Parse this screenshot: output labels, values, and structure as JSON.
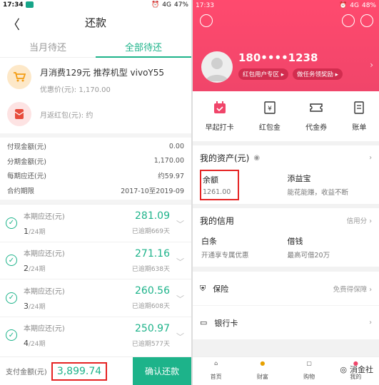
{
  "left": {
    "status": {
      "time": "17:34",
      "signal": "4G",
      "battery": "47%"
    },
    "title": "还款",
    "tabs": [
      {
        "label": "当月待还"
      },
      {
        "label": "全部待还"
      }
    ],
    "product": {
      "title": "月消费129元 推荐机型 vivoY55",
      "price_line": "优惠价(元): 1,170.00"
    },
    "redpacket": {
      "text": "月返红包(元): 约"
    },
    "info": [
      {
        "label": "付现金额(元)",
        "value": "0.00"
      },
      {
        "label": "分期金额(元)",
        "value": "1,170.00"
      },
      {
        "label": "每期应还(元)",
        "value": "约59.97"
      },
      {
        "label": "合约期限",
        "value": "2017-10至2019-09"
      }
    ],
    "installments": [
      {
        "label": "本期应还(元)",
        "period": "1",
        "total": "/24期",
        "amount": "281.09",
        "overdue": "已逾期669天"
      },
      {
        "label": "本期应还(元)",
        "period": "2",
        "total": "/24期",
        "amount": "271.16",
        "overdue": "已逾期638天"
      },
      {
        "label": "本期应还(元)",
        "period": "3",
        "total": "/24期",
        "amount": "260.56",
        "overdue": "已逾期608天"
      },
      {
        "label": "本期应还(元)",
        "period": "4",
        "total": "/24期",
        "amount": "250.97",
        "overdue": "已逾期577天"
      }
    ],
    "pay": {
      "label": "支付金额(元)",
      "amount": "3,899.74",
      "button": "确认还款"
    }
  },
  "right": {
    "status": {
      "time": "17:33",
      "signal": "4G",
      "battery": "48%"
    },
    "phone": "180••••1238",
    "pills": [
      "红包用户专区 ▸",
      "做任务领奖励 ▸"
    ],
    "quick": [
      {
        "label": "早起打卡",
        "icon": "calendar-icon"
      },
      {
        "label": "红包金",
        "icon": "yen-icon"
      },
      {
        "label": "代金券",
        "icon": "ticket-icon"
      },
      {
        "label": "账单",
        "icon": "bill-icon"
      }
    ],
    "assets_title": "我的资产(元)",
    "assets": [
      {
        "name": "余额",
        "value": "1261.00"
      },
      {
        "name": "添益宝",
        "value": "能花能赚，收益不断"
      }
    ],
    "credit_title": "我的信用",
    "credit_more": "信用分",
    "credit": [
      {
        "name": "白条",
        "value": "开通享专属优惠"
      },
      {
        "name": "借钱",
        "value": "最高可借20万"
      }
    ],
    "insurance": {
      "label": "保险",
      "more": "免费得保障"
    },
    "bankcard": {
      "label": "银行卡"
    },
    "nav": [
      "首页",
      "财富",
      "购物",
      "我的"
    ],
    "watermark": "消金社"
  },
  "colors": {
    "green": "#1db38a",
    "pink": "#f0456a",
    "red": "#e52323"
  }
}
